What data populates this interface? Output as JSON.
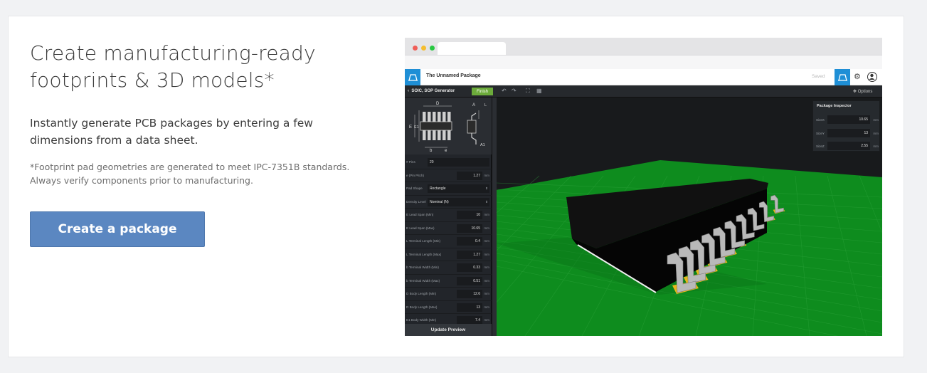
{
  "hero": {
    "headline": "Create manufacturing-ready footprints & 3D models*",
    "lead": "Instantly generate PCB packages by entering a few dimensions from a data sheet.",
    "footnote": "*Footprint pad geometries are generated to meet IPC-7351B standards. Always verify components prior to manufacturing.",
    "cta_label": "Create a package"
  },
  "colors": {
    "cta": "#5b87c1",
    "app_accent": "#1f8fd6",
    "finish_button": "#6cab3b",
    "pcb_green": "#0e8c1e",
    "pads": "#e8b71c"
  },
  "window_dots": [
    "#ef5d57",
    "#f5bd2e",
    "#28c841"
  ],
  "app": {
    "title": "The Unnamed Package",
    "status": "Saved",
    "generator_title": "SOIC, SOP Generator",
    "finish_label": "Finish",
    "options_label": "Options",
    "update_label": "Update Preview",
    "diagram_labels": {
      "d": "D",
      "e": "E",
      "e1": "E1",
      "b": "b",
      "pitch": "e",
      "a": "A",
      "a1": "A1",
      "l": "L"
    },
    "params": [
      {
        "label": "# Pins",
        "value": "20",
        "unit": ""
      },
      {
        "label": "e (Pin Pitch)",
        "value": "1.27",
        "unit": "mm"
      },
      {
        "label": "Pad Shape",
        "value": "Rectangle",
        "unit": "",
        "select": true
      },
      {
        "label": "Density Level",
        "value": "Nominal (N)",
        "unit": "",
        "select": true
      },
      {
        "label": "E Lead Span (Min)",
        "value": "10",
        "unit": "mm"
      },
      {
        "label": "E Lead Span (Max)",
        "value": "10.65",
        "unit": "mm"
      },
      {
        "label": "L Terminal Length (Min)",
        "value": "0.4",
        "unit": "mm"
      },
      {
        "label": "L Terminal Length (Max)",
        "value": "1.27",
        "unit": "mm"
      },
      {
        "label": "b Terminal Width (Min)",
        "value": "0.33",
        "unit": "mm"
      },
      {
        "label": "b Terminal Width (Max)",
        "value": "0.51",
        "unit": "mm"
      },
      {
        "label": "D Body Length (Min)",
        "value": "12.6",
        "unit": "mm"
      },
      {
        "label": "D Body Length (Max)",
        "value": "13",
        "unit": "mm"
      },
      {
        "label": "E1 Body Width (Min)",
        "value": "7.4",
        "unit": "mm"
      }
    ],
    "inspector": {
      "title": "Package Inspector",
      "rows": [
        {
          "label": "SizeX",
          "value": "10.65",
          "unit": "mm"
        },
        {
          "label": "SizeY",
          "value": "13",
          "unit": "mm"
        },
        {
          "label": "SizeZ",
          "value": "2.55",
          "unit": "mm"
        }
      ]
    }
  }
}
